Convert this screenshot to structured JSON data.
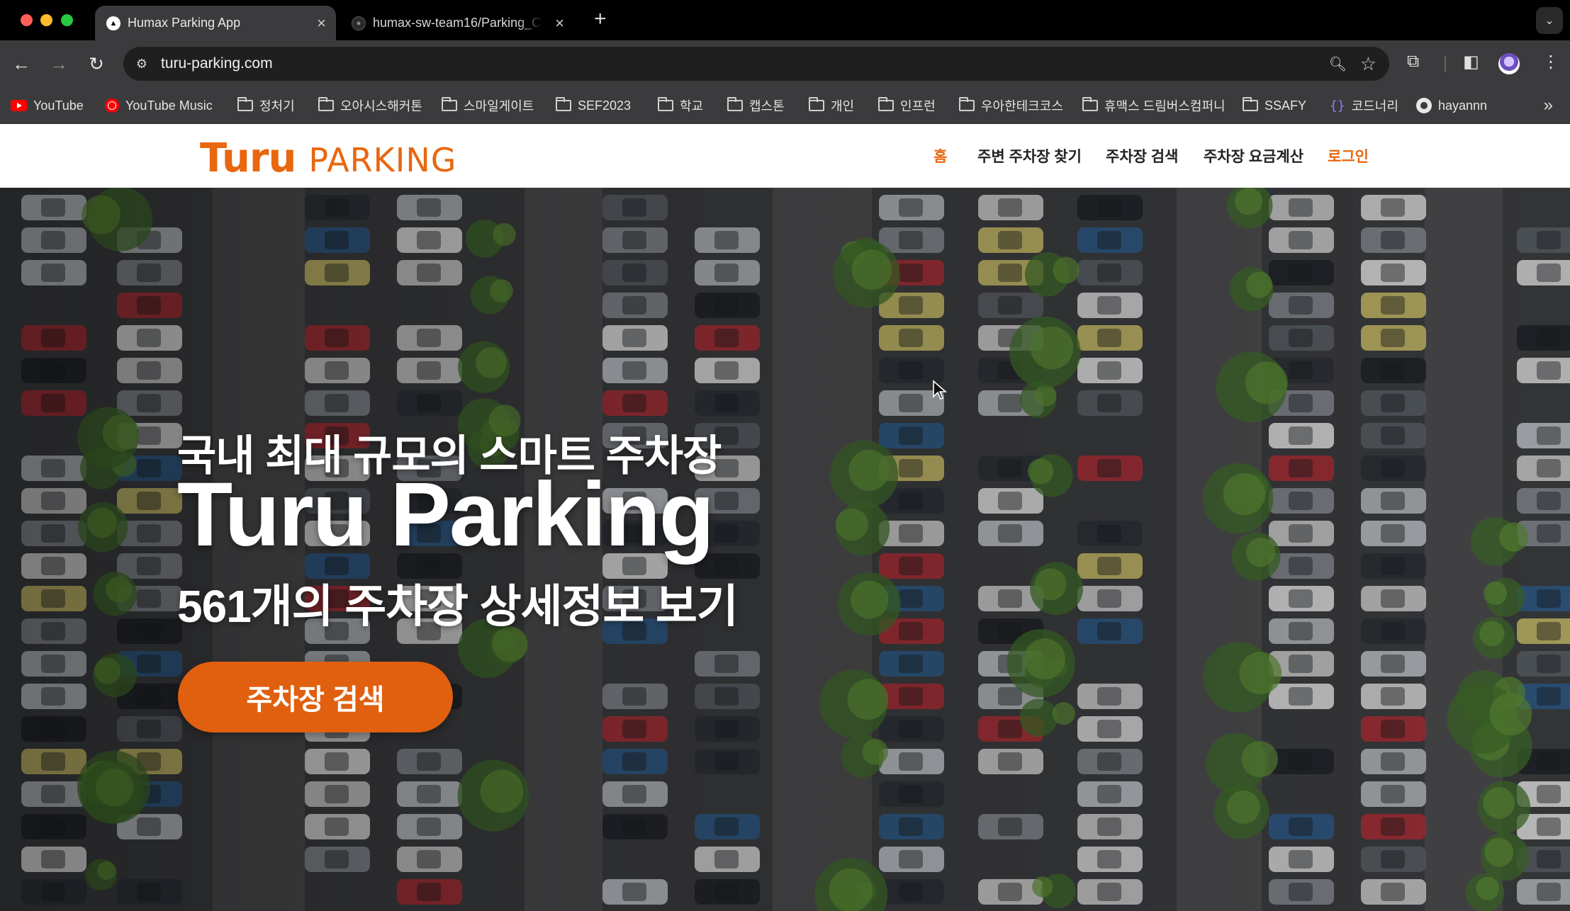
{
  "browser": {
    "tabs": [
      {
        "title": "Humax Parking App",
        "active": true
      },
      {
        "title": "humax-sw-team16/Parking_C",
        "active": false
      }
    ],
    "url": "turu-parking.com",
    "bookmarks": [
      {
        "label": "YouTube",
        "icon": "youtube-icon"
      },
      {
        "label": "YouTube Music",
        "icon": "youtube-music-icon"
      },
      {
        "label": "정처기",
        "icon": "folder-icon"
      },
      {
        "label": "오아시스해커톤",
        "icon": "folder-icon"
      },
      {
        "label": "스마일게이트",
        "icon": "folder-icon"
      },
      {
        "label": "SEF2023",
        "icon": "folder-icon"
      },
      {
        "label": "학교",
        "icon": "folder-icon"
      },
      {
        "label": "캡스톤",
        "icon": "folder-icon"
      },
      {
        "label": "개인",
        "icon": "folder-icon"
      },
      {
        "label": "인프런",
        "icon": "folder-icon"
      },
      {
        "label": "우아한테크코스",
        "icon": "folder-icon"
      },
      {
        "label": "휴맥스 드림버스컴퍼니",
        "icon": "folder-icon"
      },
      {
        "label": "SSAFY",
        "icon": "folder-icon"
      },
      {
        "label": "코드너리",
        "icon": "code-brackets-icon"
      },
      {
        "label": "hayannn",
        "icon": "github-icon"
      }
    ]
  },
  "site": {
    "logo": {
      "mark": "Turu",
      "word": "PARKING"
    },
    "nav": {
      "home": "홈",
      "nearby": "주변 주차장 찾기",
      "search": "주차장 검색",
      "fee": "주차장 요금계산",
      "login": "로그인"
    },
    "hero": {
      "subtitle": "국내 최대 규모의 스마트 주차장",
      "title": "Turu Parking",
      "count_text": "561개의 주차장 상세정보 보기",
      "cta": "주차장 검색"
    }
  },
  "colors": {
    "accent": "#e8670f",
    "cta": "#e0600f",
    "chrome_bg": "#3b3b3d"
  }
}
